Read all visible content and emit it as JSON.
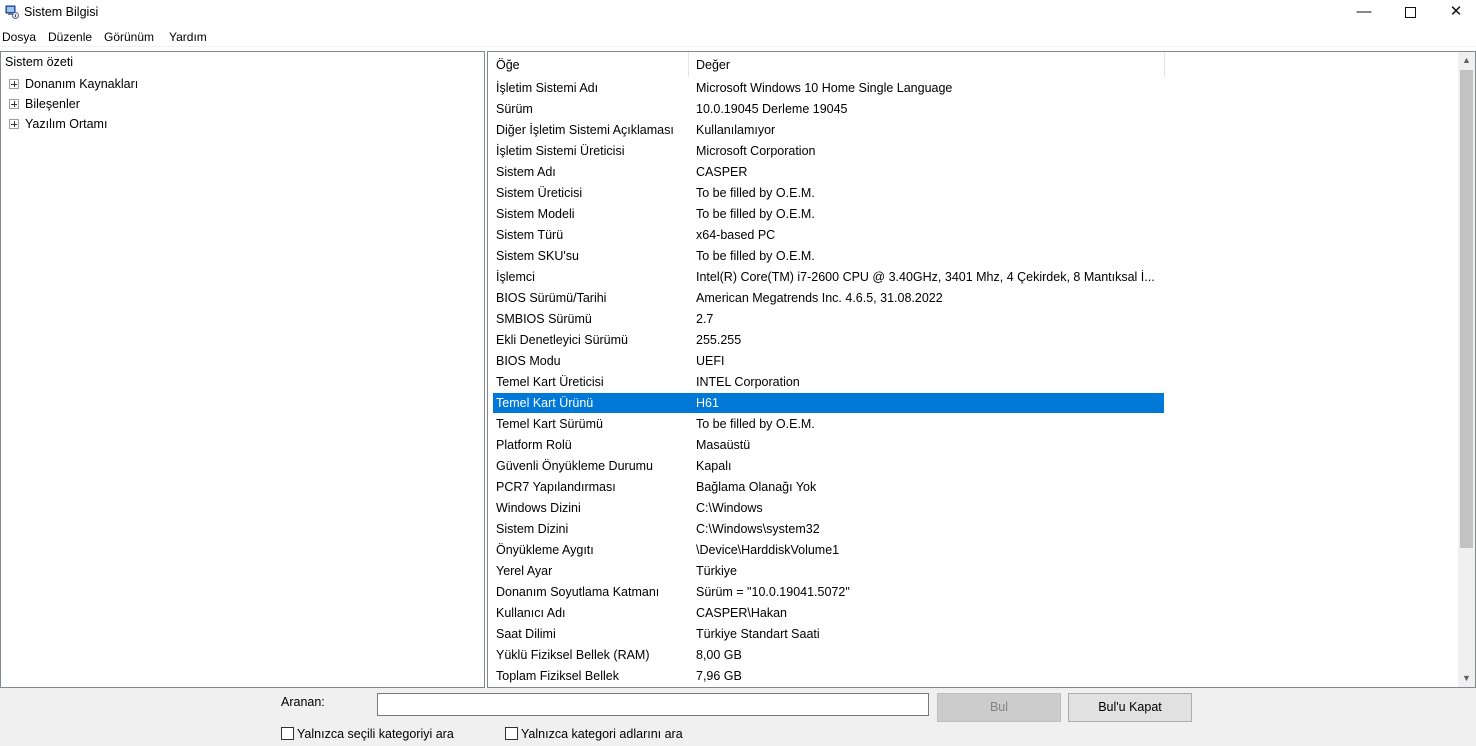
{
  "window": {
    "title": "Sistem Bilgisi"
  },
  "menu": [
    "Dosya",
    "Düzenle",
    "Görünüm",
    "Yardım"
  ],
  "tree": {
    "root": "Sistem özeti",
    "children": [
      "Donanım Kaynakları",
      "Bileşenler",
      "Yazılım Ortamı"
    ]
  },
  "list": {
    "headers": {
      "item": "Öğe",
      "value": "Değer"
    },
    "selected_index": 15,
    "rows": [
      {
        "item": "İşletim Sistemi Adı",
        "value": "Microsoft Windows 10 Home Single Language"
      },
      {
        "item": "Sürüm",
        "value": "10.0.19045 Derleme 19045"
      },
      {
        "item": "Diğer İşletim Sistemi Açıklaması",
        "value": "Kullanılamıyor"
      },
      {
        "item": "İşletim Sistemi Üreticisi",
        "value": "Microsoft Corporation"
      },
      {
        "item": "Sistem Adı",
        "value": "CASPER"
      },
      {
        "item": "Sistem Üreticisi",
        "value": "To be filled by O.E.M."
      },
      {
        "item": "Sistem Modeli",
        "value": "To be filled by O.E.M."
      },
      {
        "item": "Sistem Türü",
        "value": "x64-based PC"
      },
      {
        "item": "Sistem SKU'su",
        "value": "To be filled by O.E.M."
      },
      {
        "item": "İşlemci",
        "value": "Intel(R) Core(TM) i7-2600 CPU @ 3.40GHz, 3401 Mhz, 4 Çekirdek, 8 Mantıksal İ..."
      },
      {
        "item": "BIOS Sürümü/Tarihi",
        "value": "American Megatrends Inc. 4.6.5, 31.08.2022"
      },
      {
        "item": "SMBIOS Sürümü",
        "value": "2.7"
      },
      {
        "item": "Ekli Denetleyici Sürümü",
        "value": "255.255"
      },
      {
        "item": "BIOS Modu",
        "value": "UEFI"
      },
      {
        "item": "Temel Kart Üreticisi",
        "value": "INTEL Corporation"
      },
      {
        "item": "Temel Kart Ürünü",
        "value": "H61"
      },
      {
        "item": "Temel Kart Sürümü",
        "value": "To be filled by O.E.M."
      },
      {
        "item": "Platform Rolü",
        "value": "Masaüstü"
      },
      {
        "item": "Güvenli Önyükleme Durumu",
        "value": "Kapalı"
      },
      {
        "item": "PCR7 Yapılandırması",
        "value": "Bağlama Olanağı Yok"
      },
      {
        "item": "Windows Dizini",
        "value": "C:\\Windows"
      },
      {
        "item": "Sistem Dizini",
        "value": "C:\\Windows\\system32"
      },
      {
        "item": "Önyükleme Aygıtı",
        "value": "\\Device\\HarddiskVolume1"
      },
      {
        "item": "Yerel Ayar",
        "value": "Türkiye"
      },
      {
        "item": "Donanım Soyutlama Katmanı",
        "value": "Sürüm = \"10.0.19041.5072\""
      },
      {
        "item": "Kullanıcı Adı",
        "value": "CASPER\\Hakan"
      },
      {
        "item": "Saat Dilimi",
        "value": "Türkiye Standart Saati"
      },
      {
        "item": "Yüklü Fiziksel Bellek (RAM)",
        "value": "8,00 GB"
      },
      {
        "item": "Toplam Fiziksel Bellek",
        "value": "7,96 GB"
      }
    ]
  },
  "search": {
    "label": "Aranan:",
    "value": "",
    "find_label": "Bul",
    "close_label": "Bul'u Kapat",
    "check_selected_label": "Yalnızca seçili kategoriyi ara",
    "check_names_label": "Yalnızca kategori adlarını ara"
  },
  "colors": {
    "selection": "#0078d7",
    "panel": "#f0f0f0"
  }
}
